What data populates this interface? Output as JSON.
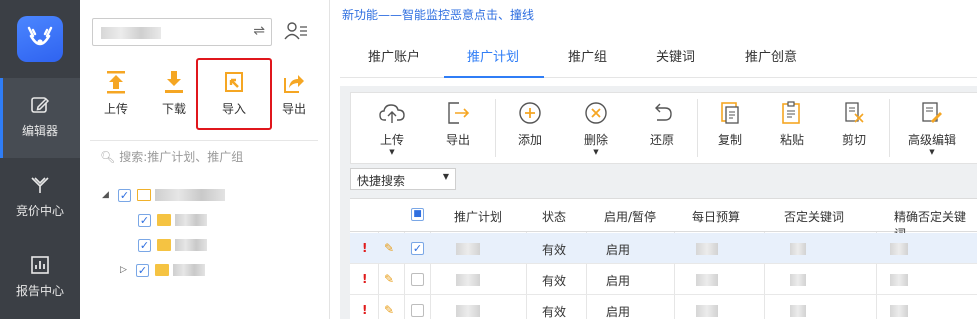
{
  "nav": {
    "items": [
      {
        "label": "编辑器",
        "icon": "edit-icon",
        "active": true
      },
      {
        "label": "竞价中心",
        "icon": "bid-icon",
        "active": false
      },
      {
        "label": "报告中心",
        "icon": "report-icon",
        "active": false
      }
    ]
  },
  "panel": {
    "tools": [
      {
        "label": "上传",
        "icon": "upload-icon"
      },
      {
        "label": "下载",
        "icon": "download-icon"
      },
      {
        "label": "导入",
        "icon": "import-icon"
      },
      {
        "label": "导出",
        "icon": "export-icon"
      }
    ],
    "search_placeholder": "搜索:推广计划、推广组"
  },
  "main": {
    "notice": "新功能——智能监控恶意点击、撞线",
    "tabs": [
      {
        "label": "推广账户",
        "active": false
      },
      {
        "label": "推广计划",
        "active": true
      },
      {
        "label": "推广组",
        "active": false
      },
      {
        "label": "关键词",
        "active": false
      },
      {
        "label": "推广创意",
        "active": false
      }
    ],
    "toolbar": [
      {
        "label": "上传",
        "icon": "cloud-upload-icon",
        "dropdown": true
      },
      {
        "label": "导出",
        "icon": "export-icon",
        "dropdown": false
      },
      {
        "label": "添加",
        "icon": "add-icon",
        "dropdown": false
      },
      {
        "label": "删除",
        "icon": "delete-icon",
        "dropdown": true
      },
      {
        "label": "还原",
        "icon": "undo-icon",
        "dropdown": false
      },
      {
        "label": "复制",
        "icon": "copy-icon",
        "dropdown": false
      },
      {
        "label": "粘贴",
        "icon": "paste-icon",
        "dropdown": false
      },
      {
        "label": "剪切",
        "icon": "cut-icon",
        "dropdown": false
      },
      {
        "label": "高级编辑",
        "icon": "advanced-edit-icon",
        "dropdown": true
      }
    ],
    "quick_search": "快捷搜索",
    "table": {
      "headers": [
        "推广计划",
        "状态",
        "启用/暂停",
        "每日预算",
        "否定关键词",
        "精确否定关键词"
      ],
      "rows": [
        {
          "status": "有效",
          "enabled": "启用",
          "checked": true
        },
        {
          "status": "有效",
          "enabled": "启用",
          "checked": false
        },
        {
          "status": "有效",
          "enabled": "启用",
          "checked": false
        }
      ]
    }
  },
  "colors": {
    "accent": "#2f7df6",
    "nav_bg": "#3b3f45",
    "highlight_border": "#e0161c"
  }
}
